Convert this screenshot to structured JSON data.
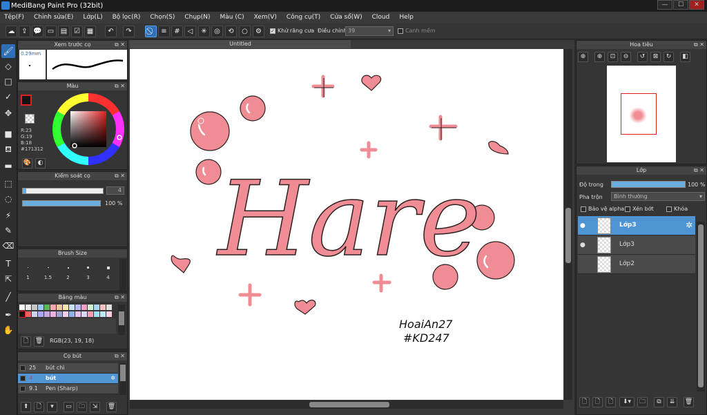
{
  "window": {
    "title": "MediBang Paint Pro (32bit)",
    "minimize": "—",
    "maximize": "☐",
    "close": "✕"
  },
  "menu": [
    "Tệp(F)",
    "Chỉnh sửa(E)",
    "Lớp(L)",
    "Bộ lọc(R)",
    "Chọn(S)",
    "Chụp(N)",
    "Màu (C)",
    "Xem(V)",
    "Công cụ(T)",
    "Cửa sổ(W)",
    "Cloud",
    "Help"
  ],
  "toolbar": {
    "antialias_label": "Khử răng cưa",
    "adjust_label": "Điều chỉnh",
    "adjust_value": "39",
    "smooth_edge_label": "Canh mềm"
  },
  "brush_preview": {
    "title": "Xem trước cọ",
    "size": "0.29mm"
  },
  "color_panel": {
    "title": "Màu",
    "r": "R:23",
    "g": "G:19",
    "b": "B:18",
    "hex": "#171312",
    "primary_color": "#171312",
    "secondary_color": "#ffffff"
  },
  "brush_control": {
    "title": "Kiểm soát cọ",
    "size_value": "4",
    "opacity_value": "100 %",
    "opacity_fraction": 1.0
  },
  "brush_size": {
    "title": "Brush Size",
    "sizes": [
      "1",
      "1.5",
      "2",
      "3",
      "4"
    ]
  },
  "palette": {
    "title": "Bảng màu",
    "rgb_text": "RGB(23, 19, 18)",
    "colors_row1": [
      "#ffffff",
      "#e8e8e8",
      "#c8c8c8",
      "#98c8f0",
      "#58b858",
      "#f8a8a8",
      "#f0c8a0",
      "#f8e8a8",
      "#c8e0f8",
      "#b8b8f8",
      "#f0a0c8",
      "#d0f0d0",
      "#a8d8f0",
      "#f8c0c0",
      "#e0e0e0"
    ],
    "colors_row2": [
      "#171312",
      "#f06060",
      "#d0d0f0",
      "#a8a8f8",
      "#c8a8e0",
      "#f0b0e0",
      "#a0a0d0",
      "#f0d0f0",
      "#90b0e8",
      "#e8c0f0",
      "#d8d8ff",
      "#f8a0b0",
      "#a0e0f0",
      "#c0e8ff",
      "#ffd0e8"
    ]
  },
  "brush_list": {
    "title": "Cọ bút",
    "items": [
      {
        "size": "25",
        "name": "bút chì"
      },
      {
        "size": "4",
        "name": "bút"
      },
      {
        "size": "9.1",
        "name": "Pen (Sharp)"
      }
    ]
  },
  "canvas": {
    "tab_title": "Untitled",
    "main_text": "Hare",
    "signature_line1": "HoaiAn27",
    "signature_line2": "#KD247",
    "accent_pink": "#f08c94"
  },
  "navigator": {
    "title": "Hoa tiêu"
  },
  "layer_panel": {
    "title": "Lớp",
    "opacity_label": "Độ trong",
    "opacity_value": "100 %",
    "opacity_fraction": 1.0,
    "blend_label": "Pha trộn",
    "blend_value": "Bình thường",
    "alpha_protect_label": "Bảo vệ alpha",
    "clip_label": "Xén bớt",
    "lock_label": "Khóa",
    "layers": [
      "Lớp3",
      "Lớp3",
      "Lớp2"
    ]
  }
}
